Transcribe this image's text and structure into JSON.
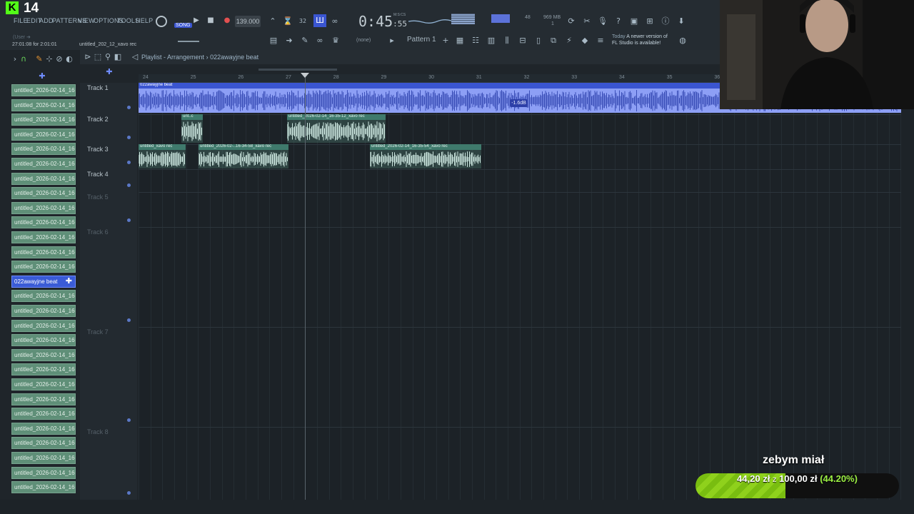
{
  "overlay": {
    "viewer_count": "14",
    "donation_title": "zebym miał",
    "donation_current": "44,20 zł",
    "donation_of": "z",
    "donation_goal": "100,00 zł",
    "donation_percent_label": "(44.20%)",
    "donation_progress": 0.442
  },
  "menu": [
    "FILE",
    "EDIT",
    "ADD",
    "PATTERNS",
    "VIEW",
    "OPTIONS",
    "TOOLS",
    "HELP"
  ],
  "transport": {
    "song_mode": "SONG",
    "tempo": "139.000",
    "time": "0:45",
    "time_sub": ":55",
    "time_unit": "M:S:CS",
    "user_label": "(User ➜",
    "hint": "27:01:08 for 2:01:01",
    "rec_label": "untitled_202_12_xavo rec",
    "cpu": "48",
    "memory": "969 MB",
    "memory_sub": "1",
    "pattern": "Pattern 1",
    "none_label": "(none)",
    "update_line1": "Today",
    "update_line2": "A newer version of",
    "update_line3": "FL Studio is available!"
  },
  "playlist": {
    "title": "Playlist - Arrangement",
    "breadcrumb_sep": "›",
    "pattern": "022awayjne beat",
    "bar_numbers": [
      "24",
      "25",
      "26",
      "27",
      "28",
      "29",
      "30",
      "31",
      "32",
      "33",
      "34",
      "35",
      "36"
    ],
    "tracks": [
      "Track 1",
      "Track 2",
      "Track 3",
      "Track 4",
      "Track 5",
      "Track 6",
      "Track 7",
      "Track 8"
    ],
    "clips": {
      "beat": "022awayjne beat",
      "beat_gain": "-1.6dB",
      "t2_a": "unt..c",
      "t2_b": "untitled_2026-02-14_16-35-12_xavo rec",
      "t3_a": "untitled_xavo rec",
      "t3_b": "untitled_2026-02-..16-34-58_xavo rec",
      "t3_c": "untitled_2026-02-14_16-35-54_xavo rec"
    }
  },
  "browser": {
    "item_label": "untitled_2026-02-14_16-",
    "selected_label": "022awayjne beat"
  },
  "colors": {
    "accent": "#3a55d1",
    "clip_green": "#5f8f78",
    "donation_green": "#8fd11c",
    "kick_green": "#53fc18"
  }
}
